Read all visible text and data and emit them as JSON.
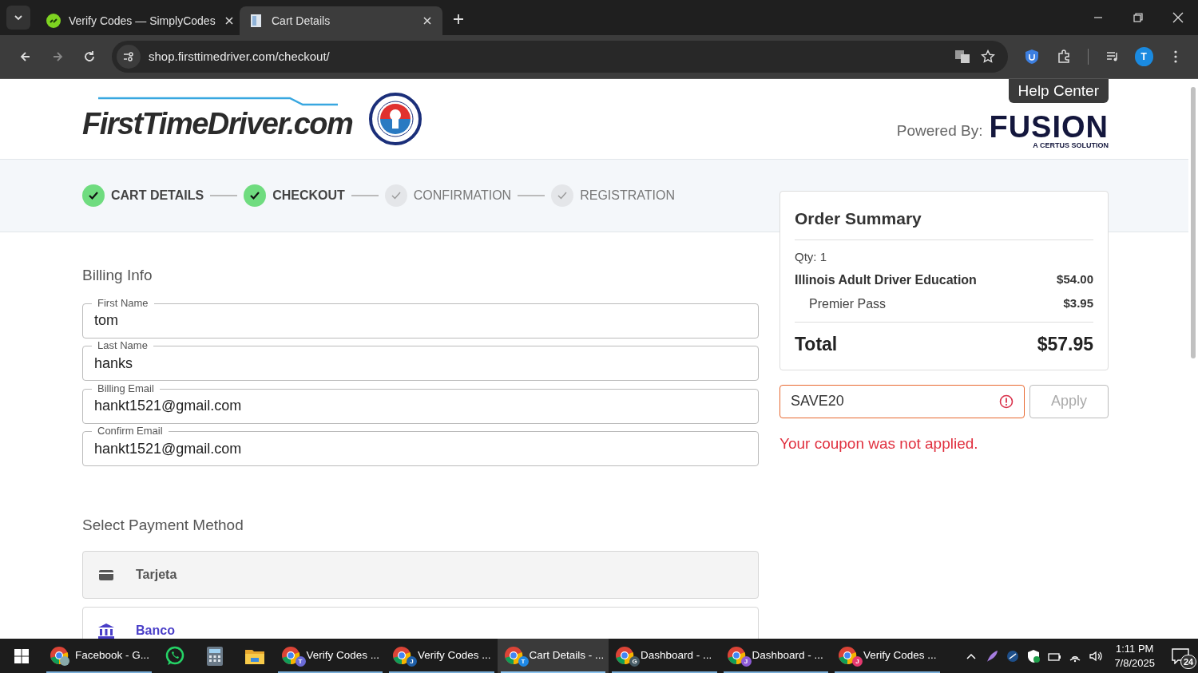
{
  "browser": {
    "tabs": [
      {
        "title": "Verify Codes — SimplyCodes",
        "kind": "simplycodes",
        "selected": false
      },
      {
        "title": "Cart Details",
        "kind": "document",
        "selected": true
      }
    ],
    "address": "shop.firsttimedriver.com/checkout/",
    "profile_initial": "T"
  },
  "header": {
    "logo": "FirstTimeDriver.com",
    "help": "Help Center",
    "powered_by": "Powered By:",
    "brand": "FUSION",
    "brand_tagline": "A CERTUS SOLUTION"
  },
  "steps": [
    {
      "label": "CART DETAILS",
      "done": true
    },
    {
      "label": "CHECKOUT",
      "done": true
    },
    {
      "label": "CONFIRMATION",
      "done": false
    },
    {
      "label": "REGISTRATION",
      "done": false
    }
  ],
  "billing": {
    "title": "Billing Info",
    "fields": [
      {
        "label": "First Name",
        "value": "tom"
      },
      {
        "label": "Last Name",
        "value": "hanks"
      },
      {
        "label": "Billing Email",
        "value": "hankt1521@gmail.com"
      },
      {
        "label": "Confirm Email",
        "value": "hankt1521@gmail.com"
      }
    ]
  },
  "payment": {
    "title": "Select Payment Method",
    "methods": [
      {
        "label": "Tarjeta",
        "kind": "card",
        "selected": false
      },
      {
        "label": "Banco",
        "kind": "bank",
        "selected": true
      }
    ]
  },
  "summary": {
    "title": "Order Summary",
    "qty": "Qty: 1",
    "items": [
      {
        "name": "Illinois Adult Driver Education",
        "price": "$54.00",
        "kind": "main"
      },
      {
        "name": "Premier Pass",
        "price": "$3.95",
        "kind": "addon"
      }
    ],
    "total_label": "Total",
    "total": "$57.95"
  },
  "coupon": {
    "value": "SAVE20",
    "error": true,
    "button": "Apply",
    "message": "Your coupon was not applied."
  },
  "taskbar": {
    "apps": [
      {
        "label": "Facebook - G...",
        "kind": "chrome",
        "running": true,
        "selected": false
      },
      {
        "kind": "whatsapp",
        "running": false,
        "selected": false
      },
      {
        "kind": "calculator",
        "running": false,
        "selected": false
      },
      {
        "kind": "explorer",
        "running": false,
        "selected": false
      },
      {
        "label": "Verify Codes ...",
        "kind": "chrome",
        "badge": "T",
        "color": "#6b6bd6",
        "running": true,
        "selected": false
      },
      {
        "label": "Verify Codes ...",
        "kind": "chrome",
        "badge": "J",
        "color": "#1f5fa8",
        "running": true,
        "selected": false
      },
      {
        "label": "Cart Details - ...",
        "kind": "chrome",
        "badge": "T",
        "color": "#1e88e5",
        "running": true,
        "selected": true
      },
      {
        "label": "Dashboard - ...",
        "kind": "chrome",
        "badge": "G",
        "color": "#455a64",
        "running": true,
        "selected": false
      },
      {
        "label": "Dashboard - ...",
        "kind": "chrome",
        "badge": "J",
        "color": "#8e5bd6",
        "running": true,
        "selected": false
      },
      {
        "label": "Verify Codes ...",
        "kind": "chrome",
        "badge": "J",
        "color": "#e53970",
        "running": true,
        "selected": false
      }
    ],
    "time": "1:11 PM",
    "date": "7/8/2025",
    "notifications": "24"
  }
}
